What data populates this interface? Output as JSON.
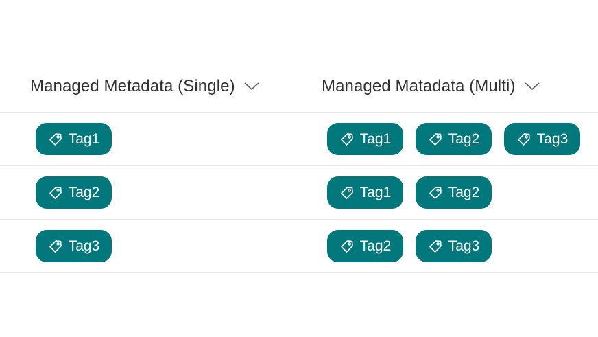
{
  "columns": {
    "single": {
      "title": "Managed Metadata (Single)",
      "icon": "chevron-down-icon"
    },
    "multi": {
      "title": "Managed Matadata (Multi)",
      "icon": "chevron-down-icon"
    }
  },
  "tag_style": {
    "background": "#03787c",
    "text_color": "#ffffff",
    "icon": "tag-icon"
  },
  "rows": [
    {
      "single": [
        "Tag1"
      ],
      "multi": [
        "Tag1",
        "Tag2",
        "Tag3"
      ]
    },
    {
      "single": [
        "Tag2"
      ],
      "multi": [
        "Tag1",
        "Tag2"
      ]
    },
    {
      "single": [
        "Tag3"
      ],
      "multi": [
        "Tag2",
        "Tag3"
      ]
    }
  ]
}
